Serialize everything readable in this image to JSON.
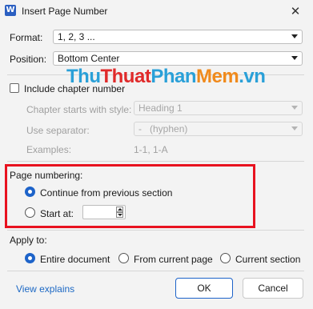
{
  "window": {
    "title": "Insert Page Number",
    "app_icon_letter": "W",
    "close_glyph": "✕"
  },
  "format": {
    "label": "Format:",
    "value": "1, 2, 3 ..."
  },
  "position": {
    "label": "Position:",
    "value": "Bottom Center"
  },
  "chapter": {
    "include_label": "Include chapter number",
    "include_checked": false,
    "starts_with_label": "Chapter starts with style:",
    "starts_with_value": "Heading 1",
    "separator_label": "Use separator:",
    "separator_value": "-   (hyphen)",
    "examples_label": "Examples:",
    "examples_value": "1-1, 1-A"
  },
  "watermark": {
    "part1": "Thu",
    "part2": "Thuat",
    "part3": "Phan",
    "part4": "Mem",
    "part5": ".vn"
  },
  "page_numbering": {
    "label": "Page numbering:",
    "continue_label": "Continue from previous section",
    "start_at_label": "Start at:",
    "start_at_value": "",
    "selected": "continue"
  },
  "apply_to": {
    "label": "Apply to:",
    "options": [
      "Entire document",
      "From current page",
      "Current section"
    ],
    "selected": "Entire document"
  },
  "footer": {
    "view_explains": "View explains",
    "ok": "OK",
    "cancel": "Cancel"
  }
}
